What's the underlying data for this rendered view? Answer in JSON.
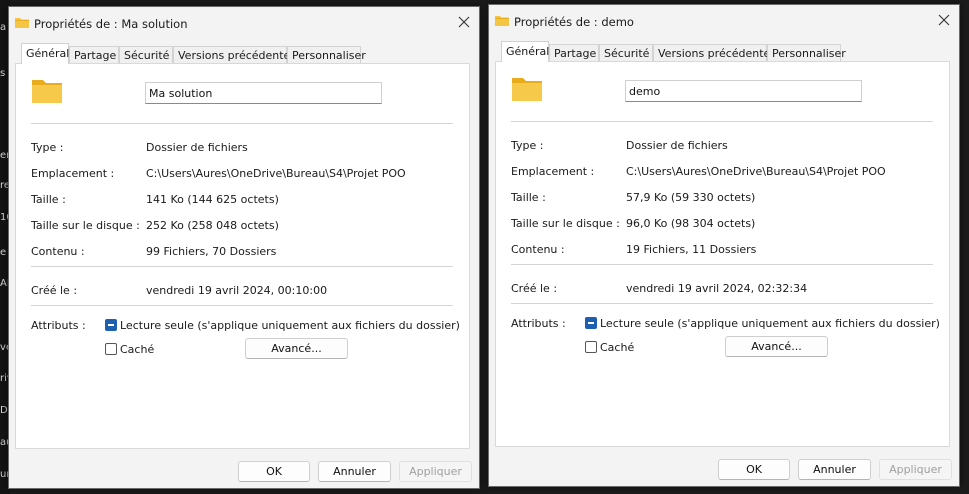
{
  "background": {
    "edge_chars": [
      "a",
      "s",
      "er",
      "re",
      "10",
      "e",
      "AI",
      "ve",
      "riv",
      "Da",
      "au",
      "ur"
    ]
  },
  "windows": [
    {
      "title": "Propriétés de : Ma solution",
      "tabs": [
        "Général",
        "Partage",
        "Sécurité",
        "Versions précédentes",
        "Personnaliser"
      ],
      "active_tab": "Général",
      "name_value": "Ma solution",
      "props": [
        {
          "label": "Type :",
          "value": "Dossier de fichiers"
        },
        {
          "label": "Emplacement :",
          "value": "C:\\Users\\Aures\\OneDrive\\Bureau\\S4\\Projet POO"
        },
        {
          "label": "Taille :",
          "value": "141 Ko (144 625 octets)"
        },
        {
          "label": "Taille sur le disque :",
          "value": "252 Ko (258 048 octets)"
        },
        {
          "label": "Contenu :",
          "value": "99 Fichiers, 70 Dossiers"
        }
      ],
      "created": {
        "label": "Créé le :",
        "value": "vendredi 19 avril 2024, 00:10:00"
      },
      "attributes_label": "Attributs :",
      "readonly_label": "Lecture seule (s'applique uniquement aux fichiers du dossier)",
      "hidden_label": "Caché",
      "advanced_label": "Avancé...",
      "buttons": {
        "ok": "OK",
        "cancel": "Annuler",
        "apply": "Appliquer"
      }
    },
    {
      "title": "Propriétés de : demo",
      "tabs": [
        "Général",
        "Partage",
        "Sécurité",
        "Versions précédentes",
        "Personnaliser"
      ],
      "active_tab": "Général",
      "name_value": "demo",
      "props": [
        {
          "label": "Type :",
          "value": "Dossier de fichiers"
        },
        {
          "label": "Emplacement :",
          "value": "C:\\Users\\Aures\\OneDrive\\Bureau\\S4\\Projet POO"
        },
        {
          "label": "Taille :",
          "value": "57,9 Ko (59 330 octets)"
        },
        {
          "label": "Taille sur le disque :",
          "value": "96,0 Ko (98 304 octets)"
        },
        {
          "label": "Contenu :",
          "value": "19 Fichiers, 11 Dossiers"
        }
      ],
      "created": {
        "label": "Créé le :",
        "value": "vendredi 19 avril 2024, 02:32:34"
      },
      "attributes_label": "Attributs :",
      "readonly_label": "Lecture seule (s'applique uniquement aux fichiers du dossier)",
      "hidden_label": "Caché",
      "advanced_label": "Avancé...",
      "buttons": {
        "ok": "OK",
        "cancel": "Annuler",
        "apply": "Appliquer"
      }
    }
  ],
  "colors": {
    "accent": "#1f5fb0",
    "folder": "#f4c542",
    "folder_dark": "#e8ac1c"
  }
}
